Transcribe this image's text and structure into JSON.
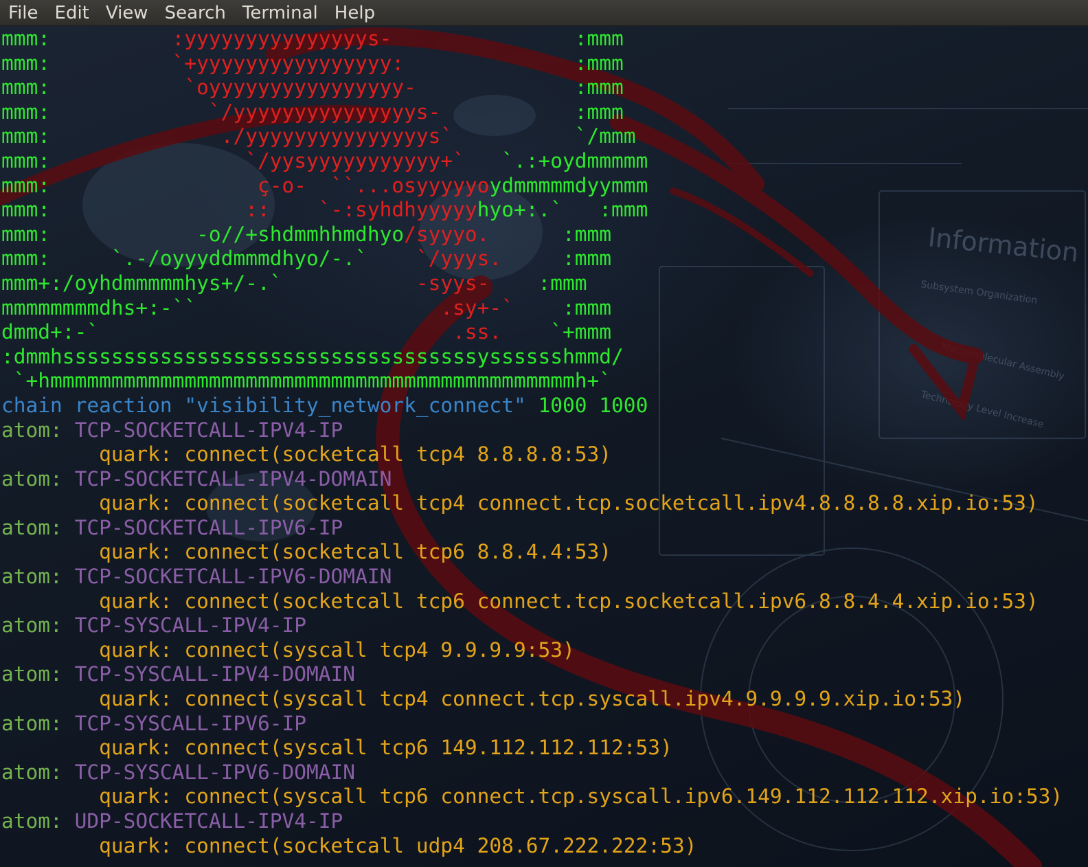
{
  "menu": {
    "items": [
      "File",
      "Edit",
      "View",
      "Search",
      "Terminal",
      "Help"
    ]
  },
  "colors": {
    "ascii_green": "#2ee82e",
    "ascii_red": "#e0201e",
    "chain_blue": "#3a84c8",
    "atom_label_green": "#74b24f",
    "atom_name_purple": "#8a5ea6",
    "quark_orange": "#e3a419"
  },
  "background_text": {
    "information": "Information",
    "subsystem": "Subsystem Organization",
    "macro": "Macromolecular Assembly",
    "tech": "Technology Level Increase"
  },
  "ascii_art": [
    [
      {
        "c": "g",
        "t": "mmm:"
      },
      {
        "c": "r",
        "t": "          :yyyyyyyyyyyyyyys-"
      },
      {
        "c": "g",
        "t": "               :mmm"
      }
    ],
    [
      {
        "c": "g",
        "t": "mmm:"
      },
      {
        "c": "r",
        "t": "          `+yyyyyyyyyyyyyyyy:"
      },
      {
        "c": "g",
        "t": "              :mmm"
      }
    ],
    [
      {
        "c": "g",
        "t": "mmm:"
      },
      {
        "c": "r",
        "t": "           `oyyyyyyyyyyyyyyyy-"
      },
      {
        "c": "g",
        "t": "             :mmm"
      }
    ],
    [
      {
        "c": "g",
        "t": "mmm:"
      },
      {
        "c": "r",
        "t": "             `/yyyyyyyyyyyyyyys-"
      },
      {
        "c": "g",
        "t": "           :mmm"
      }
    ],
    [
      {
        "c": "g",
        "t": "mmm:"
      },
      {
        "c": "r",
        "t": "              ./yyyyyyyyyyyyyyys`"
      },
      {
        "c": "g",
        "t": "          `/mmm"
      }
    ],
    [
      {
        "c": "g",
        "t": "mmm:"
      },
      {
        "c": "r",
        "t": "                `/yysyyyyyyyyyyy+`"
      },
      {
        "c": "g",
        "t": "   `.:+oydmmmmm"
      }
    ],
    [
      {
        "c": "g",
        "t": "mmm:"
      },
      {
        "c": "r",
        "t": "                 ç-o-  ``...osyyyyyo"
      },
      {
        "c": "g",
        "t": "ydmmmmmdyymmm"
      }
    ],
    [
      {
        "c": "g",
        "t": "mmm:"
      },
      {
        "c": "r",
        "t": "                ::    `-:syhdhyyyyy"
      },
      {
        "c": "g",
        "t": "hyo+:.`   :mmm"
      }
    ],
    [
      {
        "c": "g",
        "t": "mmm:"
      },
      {
        "c": "g",
        "t": "            -o//+shdmmhhmdhyo"
      },
      {
        "c": "r",
        "t": "/syyyo."
      },
      {
        "c": "g",
        "t": "      :mmm"
      }
    ],
    [
      {
        "c": "g",
        "t": "mmm:"
      },
      {
        "c": "g",
        "t": "     `.-/oyyyddmmmdhyo/-.`"
      },
      {
        "c": "r",
        "t": "    `/yyys."
      },
      {
        "c": "g",
        "t": "     :mmm"
      }
    ],
    [
      {
        "c": "g",
        "t": "mmm+:/oyhdmmmmmhys+/-.`"
      },
      {
        "c": "r",
        "t": "           -syys-"
      },
      {
        "c": "g",
        "t": "    :mmm"
      }
    ],
    [
      {
        "c": "g",
        "t": "mmmmmmmmdhs+:-``"
      },
      {
        "c": "r",
        "t": "                    .sy+-`"
      },
      {
        "c": "g",
        "t": "    :mmm"
      }
    ],
    [
      {
        "c": "g",
        "t": "dmmd+:-`"
      },
      {
        "c": "r",
        "t": "                             .ss."
      },
      {
        "c": "g",
        "t": "    `+mmm"
      }
    ],
    [
      {
        "c": "g",
        "t": ":dmmhssssssssssssssssssssssssssssssssssysssssshmmd/"
      }
    ],
    [
      {
        "c": "g",
        "t": " `+hmmmmmmmmmmmmmmmmmmmmmmmmmmmmmmmmmmmmmmmmmmmh+`"
      }
    ]
  ],
  "chain": {
    "keyword": "chain reaction",
    "name": "\"visibility_network_connect\"",
    "numbers": " 1000 1000"
  },
  "atoms": [
    {
      "label": "atom: ",
      "name": "TCP-SOCKETCALL-IPV4-IP",
      "quark": "        quark: connect(socketcall tcp4 8.8.8.8:53)"
    },
    {
      "label": "atom: ",
      "name": "TCP-SOCKETCALL-IPV4-DOMAIN",
      "quark": "        quark: connect(socketcall tcp4 connect.tcp.socketcall.ipv4.8.8.8.8.xip.io:53)"
    },
    {
      "label": "atom: ",
      "name": "TCP-SOCKETCALL-IPV6-IP",
      "quark": "        quark: connect(socketcall tcp6 8.8.4.4:53)"
    },
    {
      "label": "atom: ",
      "name": "TCP-SOCKETCALL-IPV6-DOMAIN",
      "quark": "        quark: connect(socketcall tcp6 connect.tcp.socketcall.ipv6.8.8.4.4.xip.io:53)"
    },
    {
      "label": "atom: ",
      "name": "TCP-SYSCALL-IPV4-IP",
      "quark": "        quark: connect(syscall tcp4 9.9.9.9:53)"
    },
    {
      "label": "atom: ",
      "name": "TCP-SYSCALL-IPV4-DOMAIN",
      "quark": "        quark: connect(syscall tcp4 connect.tcp.syscall.ipv4.9.9.9.9.xip.io:53)"
    },
    {
      "label": "atom: ",
      "name": "TCP-SYSCALL-IPV6-IP",
      "quark": "        quark: connect(syscall tcp6 149.112.112.112:53)"
    },
    {
      "label": "atom: ",
      "name": "TCP-SYSCALL-IPV6-DOMAIN",
      "quark": "        quark: connect(syscall tcp6 connect.tcp.syscall.ipv6.149.112.112.112.xip.io:53)"
    },
    {
      "label": "atom: ",
      "name": "UDP-SOCKETCALL-IPV4-IP",
      "quark": "        quark: connect(socketcall udp4 208.67.222.222:53)"
    }
  ]
}
